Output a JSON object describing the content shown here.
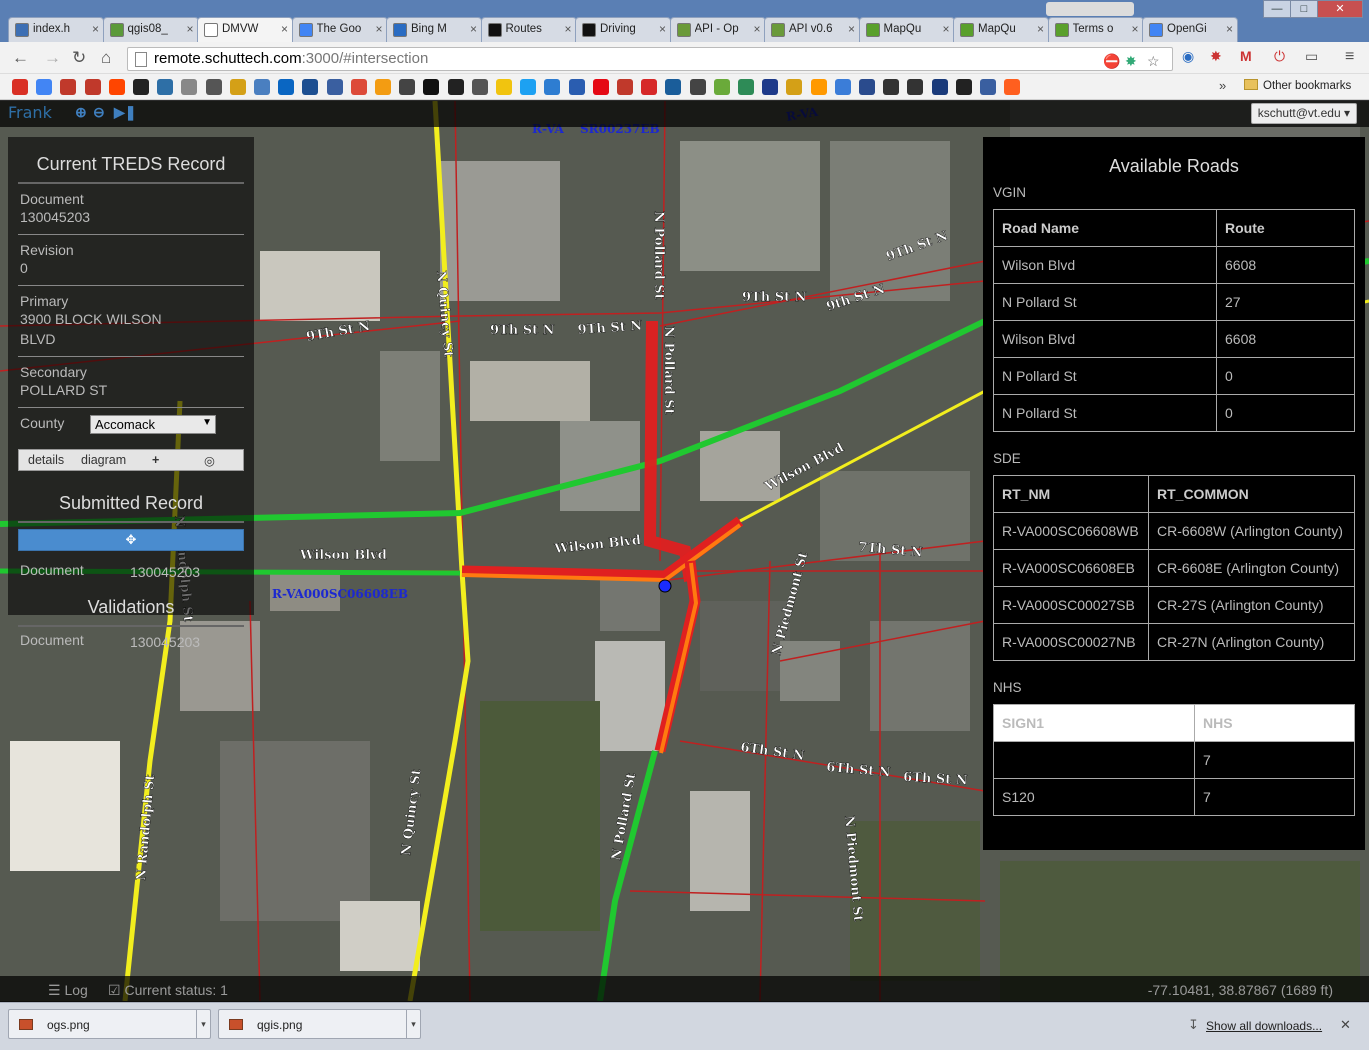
{
  "browser": {
    "tabs": [
      {
        "label": "index.h",
        "color": "#3d6fb4"
      },
      {
        "label": "qgis08_",
        "color": "#5c9a3a"
      },
      {
        "label": "DMVW",
        "color": "#ffffff"
      },
      {
        "label": "The Goo",
        "color": "#4285f4"
      },
      {
        "label": "Bing M",
        "color": "#2a6cc2"
      },
      {
        "label": "Routes",
        "color": "#111111"
      },
      {
        "label": "Driving",
        "color": "#111111"
      },
      {
        "label": "API - Op",
        "color": "#6a9a3a"
      },
      {
        "label": "API v0.6",
        "color": "#6a9a3a"
      },
      {
        "label": "MapQu",
        "color": "#5aa02c"
      },
      {
        "label": "MapQu",
        "color": "#5aa02c"
      },
      {
        "label": "Terms o",
        "color": "#5aa02c"
      },
      {
        "label": "OpenGi",
        "color": "#4285f4"
      }
    ],
    "url_host": "remote.schuttech.com",
    "url_path": ":3000/#intersection",
    "other_bookmarks": "Other bookmarks",
    "bookmark_icons": [
      "gmail-icon",
      "calendar-icon",
      "arc-icon",
      "arc-icon",
      "reddit-icon",
      "github-icon",
      "reply-icon",
      "tree-icon",
      "re-icon",
      "r-icon",
      "settings-icon",
      "linkedin-icon",
      "p-icon",
      "twc-icon",
      "gplus-icon",
      "orange-icon",
      "wsj-icon",
      "nyt-icon",
      "wp-icon",
      "wikipedia-icon",
      "lemon-icon",
      "twitter-icon",
      "map-pin-icon",
      "sxm-icon",
      "netflix-icon",
      "red-icon",
      "red2-icon",
      "grid-icon",
      "eye-icon",
      "leaf-icon",
      "globe-icon",
      "pga-icon",
      "box-icon",
      "amazon-icon",
      "paw-icon",
      "badge-icon",
      "p2-icon",
      "p3-icon",
      "mlb-icon",
      "nhl-icon",
      "shield-icon",
      "nlp-icon"
    ]
  },
  "app": {
    "brand": "Frank",
    "user": "kschutt@vt.edu"
  },
  "left_panel": {
    "title": "Current TREDS Record",
    "document_label": "Document",
    "document_value": "130045203",
    "revision_label": "Revision",
    "revision_value": "0",
    "primary_label": "Primary",
    "primary_value": "3900 BLOCK WILSON BLVD",
    "secondary_label": "Secondary",
    "secondary_value": "POLLARD ST",
    "county_label": "County",
    "county_value": "Accomack",
    "btn_details": "details",
    "btn_diagram": "diagram",
    "submitted_title": "Submitted Record",
    "submitted_doc_label": "Document",
    "submitted_doc_value": "130045203",
    "validations_title": "Validations",
    "validations_doc_label": "Document",
    "validations_doc_value": "130045203"
  },
  "right_panel": {
    "title": "Available Roads",
    "vgin_label": "VGIN",
    "vgin_headers": [
      "Road Name",
      "Route"
    ],
    "vgin_rows": [
      [
        "Wilson Blvd",
        "6608"
      ],
      [
        "N Pollard St",
        "27"
      ],
      [
        "Wilson Blvd",
        "6608"
      ],
      [
        "N Pollard St",
        "0"
      ],
      [
        "N Pollard St",
        "0"
      ]
    ],
    "sde_label": "SDE",
    "sde_headers": [
      "RT_NM",
      "RT_COMMON"
    ],
    "sde_rows": [
      [
        "R-VA000SC06608WB",
        "CR-6608W (Arlington County)"
      ],
      [
        "R-VA000SC06608EB",
        "CR-6608E (Arlington County)"
      ],
      [
        "R-VA000SC00027SB",
        "CR-27S (Arlington County)"
      ],
      [
        "R-VA000SC00027NB",
        "CR-27N (Arlington County)"
      ]
    ],
    "nhs_label": "NHS",
    "nhs_headers": [
      "SIGN1",
      "NHS"
    ],
    "nhs_rows": [
      [
        "",
        "7"
      ],
      [
        "S120",
        "7"
      ]
    ]
  },
  "map_labels": {
    "n_quincy": "N Quincy St",
    "n_pollard": "N Pollard St",
    "n_pollard_short": "N Pollard St",
    "wilson_blvd": "Wilson Blvd",
    "ninth_st": "9Th St N",
    "ninth_st2": "9th St N",
    "seventh_st": "7Th St N",
    "sixth_st": "6Th St N",
    "n_piedmont": "N Piedmont St",
    "n_randolph": "N Randolph St",
    "route_eb": "R-VA000SC06608EB",
    "route_sr": "SR00237EB",
    "rva": "R-VA"
  },
  "status": {
    "log_label": "Log",
    "status_text": "Current status: 1",
    "coords": "-77.10481, 38.87867 (1689 ft)"
  },
  "downloads": {
    "items": [
      "ogs.png",
      "qgis.png"
    ],
    "show_all": "Show all downloads..."
  },
  "colors": {
    "road_yellow": "#f2ee1e",
    "road_red": "#e02020",
    "road_green": "#20c830",
    "road_orange": "#ff7a10",
    "route_label_blue": "#1c28d0"
  }
}
